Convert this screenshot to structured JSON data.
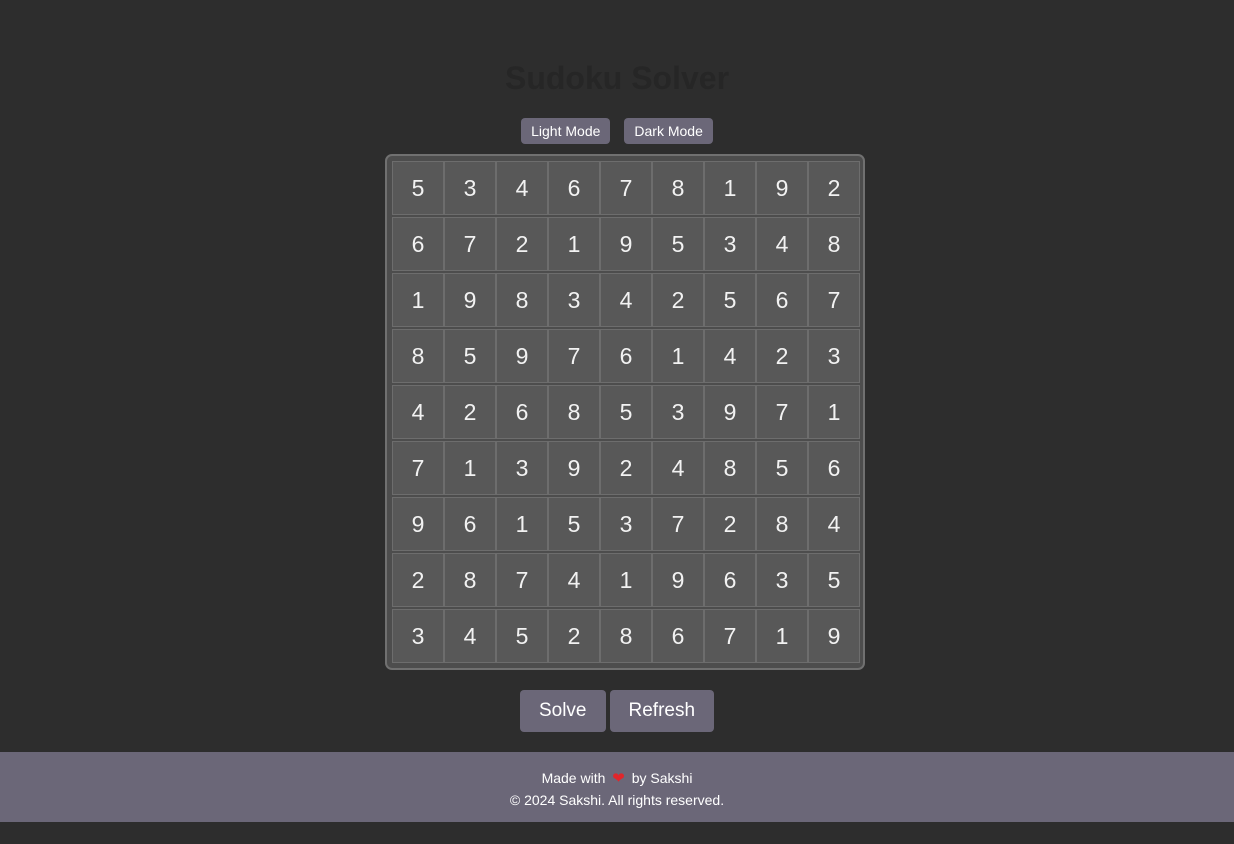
{
  "page": {
    "title": "Sudoku Solver"
  },
  "modes": {
    "light_label": "Light Mode",
    "dark_label": "Dark Mode"
  },
  "grid": [
    [
      5,
      3,
      4,
      6,
      7,
      8,
      1,
      9,
      2
    ],
    [
      6,
      7,
      2,
      1,
      9,
      5,
      3,
      4,
      8
    ],
    [
      1,
      9,
      8,
      3,
      4,
      2,
      5,
      6,
      7
    ],
    [
      8,
      5,
      9,
      7,
      6,
      1,
      4,
      2,
      3
    ],
    [
      4,
      2,
      6,
      8,
      5,
      3,
      9,
      7,
      1
    ],
    [
      7,
      1,
      3,
      9,
      2,
      4,
      8,
      5,
      6
    ],
    [
      9,
      6,
      1,
      5,
      3,
      7,
      2,
      8,
      4
    ],
    [
      2,
      8,
      7,
      4,
      1,
      9,
      6,
      3,
      5
    ],
    [
      3,
      4,
      5,
      2,
      8,
      6,
      7,
      1,
      9
    ]
  ],
  "actions": {
    "solve_label": "Solve",
    "refresh_label": "Refresh"
  },
  "footer": {
    "made_with": "Made with",
    "heart_glyph": "❤",
    "by_author": "by Sakshi",
    "copyright": "© 2024 Sakshi. All rights reserved."
  },
  "colors": {
    "background": "#2d2d2d",
    "accent": "#6b6778",
    "cell": "#585858",
    "heart": "#e0262b"
  },
  "icons": {
    "heart": "heart-icon"
  }
}
